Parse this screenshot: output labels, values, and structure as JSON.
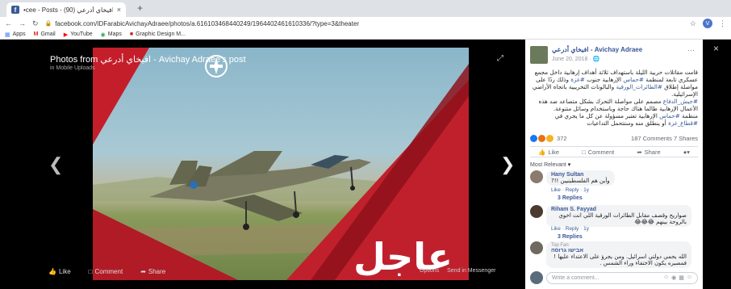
{
  "browser": {
    "tab_title": "•cee - Posts - افيخاي أدرعي (90)",
    "tab_close": "×",
    "new_tab": "+",
    "favicon": "f",
    "url": "facebook.com/IDFarabicAvichayAdraee/photos/a.616103468440249/1964402461610336/?type=3&theater",
    "profile_initial": "V",
    "bookmarks": [
      {
        "icon": "apps-grid-icon",
        "label": "Apps"
      },
      {
        "icon": "gmail-icon",
        "label": "Gmail"
      },
      {
        "icon": "youtube-icon",
        "label": "YouTube"
      },
      {
        "icon": "maps-icon",
        "label": "Maps"
      },
      {
        "icon": "folder-icon",
        "label": "Graphic Design M..."
      }
    ]
  },
  "theater": {
    "title": "Photos from افيخاي أدرعي - Avichay Adraee's post",
    "subtitle": "in Mobile Uploads",
    "breaking_text": "عاجل",
    "actions": {
      "like": "Like",
      "comment": "Comment",
      "share": "Share"
    },
    "right_actions": {
      "options": "Options",
      "send": "Send in Messenger"
    }
  },
  "post": {
    "author": "افيخاي أدرعي - Avichay Adraee",
    "date": "June 20, 2018 · 🌐",
    "text_1": "قامت مقاتلات حربية الليلة باستهداف ثلاثة أهداف إرهابية داخل مجمع عسكري تابعة لمنظمة",
    "hash_hamas": "#حماس",
    "text_2": "الإرهابية جنوب",
    "hash_gaza": "#غزة",
    "text_3": "وذلك ردًا على مواصلة إطلاق",
    "hash_kites": "#الطائرات_الورقية",
    "text_4": "والبالونات التخريبية باتجاه الأراضي الإسرائيلية.",
    "hash_idf": "#جيش_الدفاع",
    "text_5": "مصمم على مواصلة التحرك بشكل متصاعد ضد هذه الأعمال الإرهابية طالما هناك حاجة وباستخدام وسائل متنوعة.",
    "text_6": "منظمة",
    "text_7": "الإرهابية تعتبر مسؤولة عن كل ما يجري في",
    "hash_gaza_strip": "#قطاع_غزة",
    "text_8": "أو ينطلق منه وستتحمل التداعيات",
    "reaction_count": "372",
    "comments_shares": "187 Comments  7 Shares",
    "action_like": "Like",
    "action_comment": "Comment",
    "action_share": "Share",
    "most_relevant": "Most Relevant",
    "more": "···"
  },
  "comments": [
    {
      "name": "Hany Sultan",
      "text": "وأين هم الفلسطينيين !!?",
      "meta": "Like · Reply · 1y",
      "replies": "3 Replies"
    },
    {
      "name": "Riham S. Fayyad",
      "text": "صواريخ وقصف مقابل الطائرات الورقية اللي انت اخوي بالروحة بينهم 😂😂😂",
      "meta": "Like · Reply · 1y",
      "replies": "3 Replies"
    },
    {
      "name": "אבישו גרוסה",
      "badge": "Top Fan",
      "text": "الله يحمي دولتي اسرائيل. ومن يجرؤ على الاعتداء عليها ! فمصيره يكون الاختفاء وراء الشمس ."
    }
  ],
  "write_comment": {
    "placeholder": "Write a comment..."
  },
  "close": "×"
}
